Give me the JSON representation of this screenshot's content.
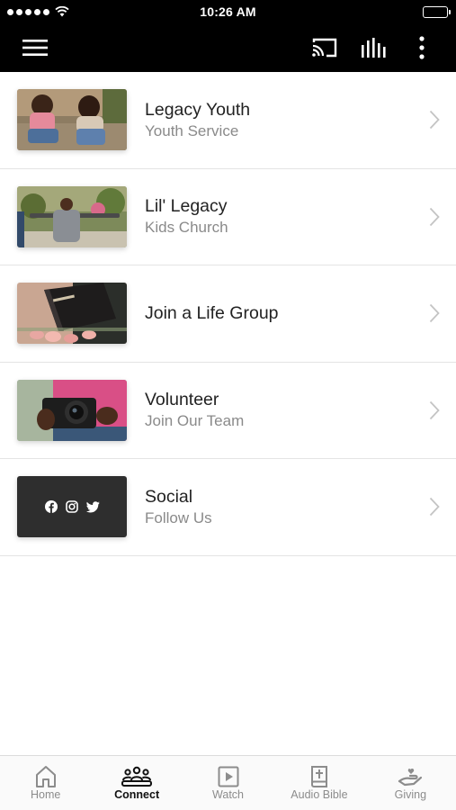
{
  "status_bar": {
    "time": "10:26 AM",
    "signal_icon": "signal-dots-icon",
    "wifi_icon": "wifi-icon",
    "battery_icon": "battery-icon"
  },
  "toolbar": {
    "menu_icon": "hamburger-menu-icon",
    "cast_icon": "cast-icon",
    "audio_icon": "audio-bars-icon",
    "more_icon": "more-vertical-icon",
    "background": "#000000"
  },
  "list": {
    "items": [
      {
        "title": "Legacy Youth",
        "subtitle": "Youth Service"
      },
      {
        "title": "Lil' Legacy",
        "subtitle": "Kids Church"
      },
      {
        "title": "Join a Life Group",
        "subtitle": ""
      },
      {
        "title": "Volunteer",
        "subtitle": "Join Our Team"
      },
      {
        "title": "Social",
        "subtitle": "Follow Us"
      }
    ]
  },
  "social_icons": [
    "facebook-icon",
    "instagram-icon",
    "twitter-icon"
  ],
  "tabbar": {
    "tabs": [
      {
        "label": "Home",
        "icon": "home-icon",
        "active": false
      },
      {
        "label": "Connect",
        "icon": "people-group-icon",
        "active": true
      },
      {
        "label": "Watch",
        "icon": "play-icon",
        "active": false
      },
      {
        "label": "Audio Bible",
        "icon": "bible-icon",
        "active": false
      },
      {
        "label": "Giving",
        "icon": "giving-hand-icon",
        "active": false
      }
    ]
  },
  "colors": {
    "title_text": "#222222",
    "subtitle_text": "#8a8a8a",
    "tab_inactive": "#8c8c8c",
    "tab_active": "#111111"
  }
}
